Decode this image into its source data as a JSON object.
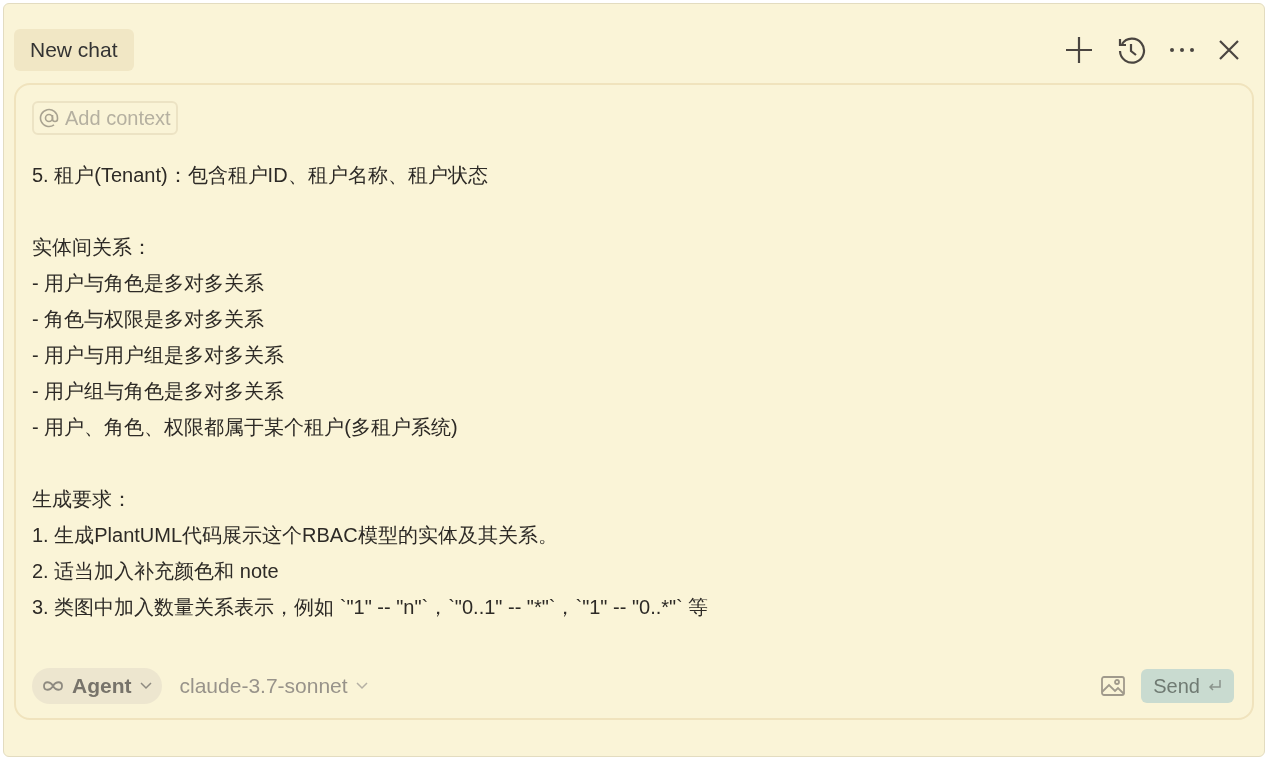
{
  "tab": {
    "label": "New chat",
    "selected": true
  },
  "context_button": {
    "label": "Add context"
  },
  "message": {
    "paragraphs": [
      [
        "5. 租户(Tenant)：包含租户ID、租户名称、租户状态"
      ],
      [
        "实体间关系：",
        "- 用户与角色是多对多关系",
        "- 角色与权限是多对多关系",
        "- 用户与用户组是多对多关系",
        "- 用户组与角色是多对多关系",
        "- 用户、角色、权限都属于某个租户(多租户系统)"
      ],
      [
        "生成要求：",
        "1. 生成PlantUML代码展示这个RBAC模型的实体及其关系。",
        "2. 适当加入补充颜色和 note",
        "3. 类图中加入数量关系表示，例如 `\"1\" -- \"n\"`，`\"0..1\" -- \"*\"`，`\"1\" -- \"0..*\"` 等"
      ]
    ]
  },
  "mode_selector": {
    "label": "Agent"
  },
  "model_selector": {
    "label": "claude-3.7-sonnet"
  },
  "send_button": {
    "label": "Send"
  }
}
